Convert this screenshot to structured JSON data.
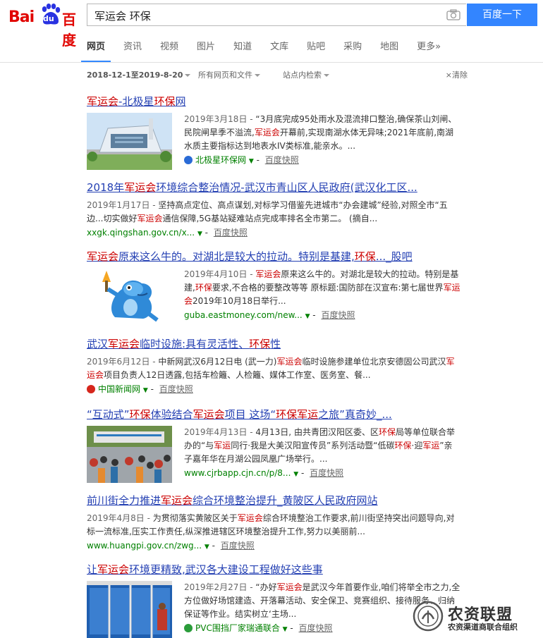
{
  "header": {
    "logo": {
      "bai": "Bai",
      "du": "du",
      "cn": "百度"
    },
    "search_value": "军运会 环保",
    "search_button": "百度一下",
    "camera_icon": "camera-icon"
  },
  "tabs": [
    "网页",
    "资讯",
    "视频",
    "图片",
    "知道",
    "文库",
    "贴吧",
    "采购",
    "地图",
    "更多»"
  ],
  "filters": {
    "date_range": "2018-12-1至2019-8-20",
    "scope": "所有网页和文件",
    "site": "站点内检索",
    "clear": "清除"
  },
  "results": [
    {
      "title_parts": [
        [
          "军运会",
          true
        ],
        [
          "-北极星",
          false
        ],
        [
          "环保",
          true
        ],
        [
          "网",
          false
        ]
      ],
      "date": "2019年3月18日",
      "abstract_parts": [
        [
          "“3月底完成95处雨水及混流排口整治,确保茶山刘闸、民院闸旱季不溢流,",
          false
        ],
        [
          "军运会",
          true
        ],
        [
          "开幕前,实现南湖水体无异味;2021年底前,南湖水质主要指标达到地表水IV类标准,能亲水。...",
          false
        ]
      ],
      "site": "北极星环保网",
      "snapshot": "百度快照"
    },
    {
      "title_parts": [
        [
          "2018年",
          false
        ],
        [
          "军运会",
          true
        ],
        [
          "环境综合整治情况-武汉市青山区人民政府(武汉化工区...",
          false
        ]
      ],
      "date": "2019年1月17日",
      "abstract_parts": [
        [
          "坚持高点定位、高点谋划,对标学习借鉴先进城市“办会建城”经验,对照全市“五边...切实做好",
          false
        ],
        [
          "军运会",
          true
        ],
        [
          "通信保障,5G基站疑难站点完成率排名全市第二。 (摘自...",
          false
        ]
      ],
      "site": "xxgk.qingshan.gov.cn/x...",
      "snapshot": "百度快照"
    },
    {
      "title_parts": [
        [
          "军运会",
          true
        ],
        [
          "原来这么牛的。对湖北是较大的拉动。特别是基建,",
          false
        ],
        [
          "环保",
          true
        ],
        [
          "..._股吧",
          false
        ]
      ],
      "date": "2019年4月10日",
      "abstract_parts": [
        [
          "军运会",
          true
        ],
        [
          "原来这么牛的。对湖北是较大的拉动。特别是基建,",
          false
        ],
        [
          "环保",
          true
        ],
        [
          "要求,不合格的要整改等等 原标题:国防部在汉宣布:第七届世界",
          false
        ],
        [
          "军运会",
          true
        ],
        [
          "2019年10月18日举行...",
          false
        ]
      ],
      "site": "guba.eastmoney.com/new...",
      "snapshot": "百度快照"
    },
    {
      "title_parts": [
        [
          "武汉",
          false
        ],
        [
          "军运会",
          true
        ],
        [
          "临时设施:具有灵活性、",
          false
        ],
        [
          "环保",
          true
        ],
        [
          "性",
          false
        ]
      ],
      "date": "2019年6月12日",
      "abstract_parts": [
        [
          "中新网武汉6月12日电 (武一力)",
          false
        ],
        [
          "军运会",
          true
        ],
        [
          "临时设施参建单位北京安德固公司武汉",
          false
        ],
        [
          "军运会",
          true
        ],
        [
          "项目负责人12日透露,包括车检籬、人检籬、媒体工作室、医务室、餐...",
          false
        ]
      ],
      "site": "中国新闻网",
      "snapshot": "百度快照"
    },
    {
      "title_parts": [
        [
          "“互动式”",
          false
        ],
        [
          "环保",
          true
        ],
        [
          "体验结合",
          false
        ],
        [
          "军运会",
          true
        ],
        [
          "项目 这场“",
          false
        ],
        [
          "环保",
          true
        ],
        [
          "军运",
          true
        ],
        [
          "之旅”真奇妙_...",
          false
        ]
      ],
      "date": "2019年4月13日",
      "abstract_parts": [
        [
          "4月13日, 由共青团汉阳区委、区",
          false
        ],
        [
          "环保",
          true
        ],
        [
          "局等单位联合举办的“与",
          false
        ],
        [
          "军运",
          true
        ],
        [
          "同行·我是大美汉阳宣传员”系列活动暨“低碳",
          false
        ],
        [
          "环保",
          true
        ],
        [
          "·迎",
          false
        ],
        [
          "军运",
          true
        ],
        [
          "”亲子嘉年华在月湖公园凤凰广场举行。...",
          false
        ]
      ],
      "site": "www.cjrbapp.cjn.cn/p/8...",
      "snapshot": "百度快照"
    },
    {
      "title_parts": [
        [
          "前川街全力推进",
          false
        ],
        [
          "军运会",
          true
        ],
        [
          "综合环境整治提升_黄陂区人民政府网站",
          false
        ]
      ],
      "date": "2019年4月8日",
      "abstract_parts": [
        [
          "为贯彻落实黄陂区关于",
          false
        ],
        [
          "军运会",
          true
        ],
        [
          "综合环境整治工作要求,前川街坚持突出问题导向,对标一流标准,压实工作责任,纵深推进辖区环境整治提升工作,努力以美丽前...",
          false
        ]
      ],
      "site": "www.huangpi.gov.cn/zwg...",
      "snapshot": "百度快照"
    },
    {
      "title_parts": [
        [
          "让",
          false
        ],
        [
          "军运会",
          true
        ],
        [
          "环境更精致,武汉各大建设工程做好这些事",
          false
        ]
      ],
      "date": "2019年2月27日",
      "abstract_parts": [
        [
          "“办好",
          false
        ],
        [
          "军运会",
          true
        ],
        [
          "是武汉今年首要作业,咱们将举全市之力,全方位做好场馆建造、开落幕活动、安全保卫、竞赛组织、接待服务、归纳保证等作业。结实树立‘主场...",
          false
        ]
      ],
      "site": "PVC围挡厂家瑞通联合",
      "snapshot": "百度快照"
    }
  ],
  "watermark": {
    "title": "农资联盟",
    "subtitle": "农资渠道商联合组织"
  },
  "colors": {
    "link": "#2440b3",
    "highlight": "#c00",
    "site": "#008000",
    "accent": "#3385ff",
    "brand": "#e10602"
  }
}
